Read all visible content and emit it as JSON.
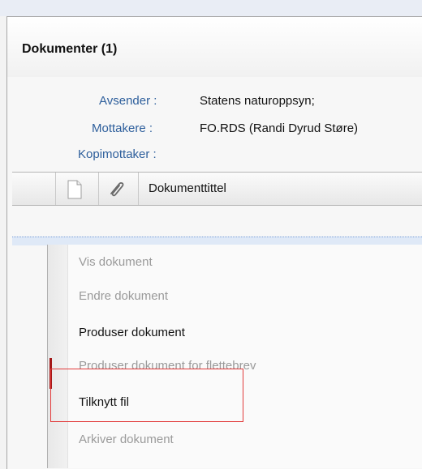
{
  "panel": {
    "title": "Dokumenter (1)"
  },
  "meta": {
    "sender_label": "Avsender :",
    "sender_value": "Statens naturoppsyn;",
    "recipients_label": "Mottakere :",
    "recipients_value": "FO.RDS (Randi Dyrud Støre)",
    "cc_label": "Kopimottaker :"
  },
  "grid": {
    "columns": {
      "document_icon": "document-icon",
      "attachment_icon": "paperclip-icon",
      "title": "Dokumenttittel"
    }
  },
  "context_menu": {
    "items": [
      {
        "label": "Vis dokument",
        "enabled": false
      },
      {
        "label": "Endre dokument",
        "enabled": false
      },
      {
        "label": "Produser dokument",
        "enabled": true
      },
      {
        "label": "Produser dokument for flettebrev",
        "enabled": false
      },
      {
        "label": "Tilknytt fil",
        "enabled": true
      },
      {
        "label": "Arkiver dokument",
        "enabled": false
      }
    ]
  },
  "colors": {
    "label_blue": "#2e5f9c",
    "highlight_red": "#e23b3b",
    "disabled_text": "#9a9a9a"
  }
}
